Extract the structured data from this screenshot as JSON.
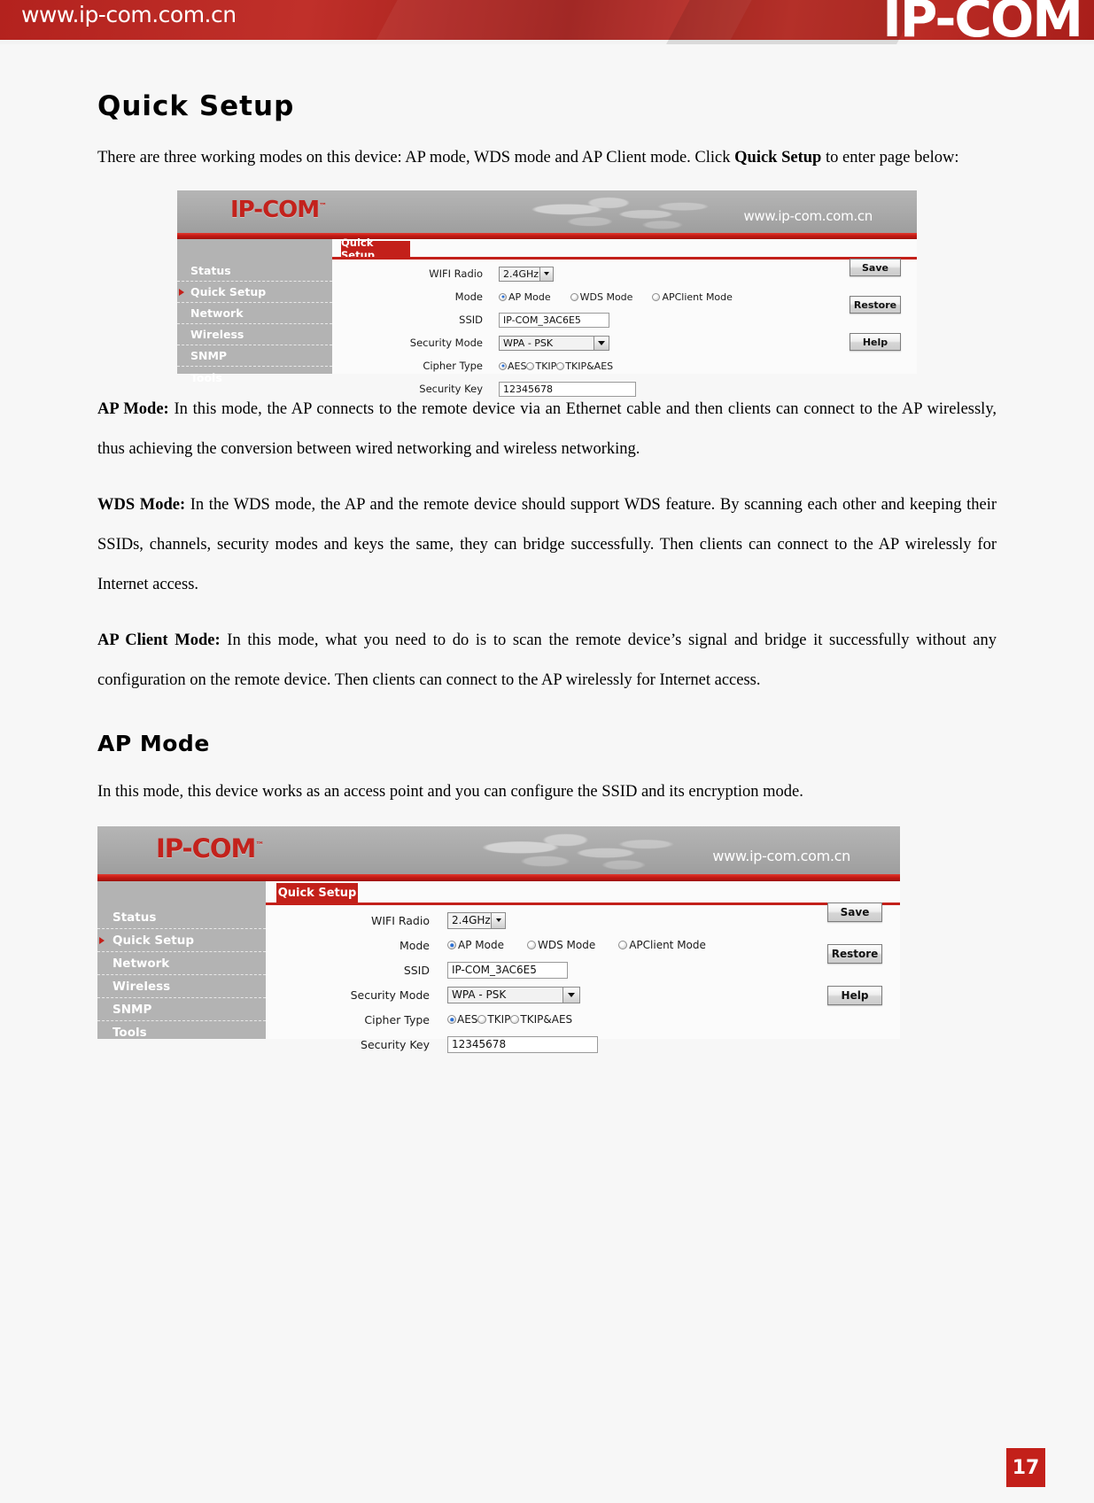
{
  "banner": {
    "url": "www.ip-com.com.cn",
    "logo": "IP-COM"
  },
  "document": {
    "title": "Quick Setup",
    "intro_part1": "There are three working modes on this device: AP mode, WDS mode and AP Client mode. Click ",
    "intro_bold": "Quick Setup",
    "intro_part2": " to enter page below:",
    "ap_mode_label": "AP Mode:",
    "ap_mode_text": " In this mode, the AP connects to the remote device via an Ethernet cable and then clients can connect to the AP wirelessly, thus achieving the conversion between wired networking and wireless networking.",
    "wds_mode_label": "WDS Mode:",
    "wds_mode_text": " In the WDS mode, the AP and the remote device should support WDS feature. By scanning each other and keeping their SSIDs, channels, security modes and keys the same, they can bridge successfully. Then clients can connect to the AP wirelessly for Internet access.",
    "ap_client_mode_label": "AP Client Mode:",
    "ap_client_mode_text": " In this mode, what you need to do is to scan the remote device’s signal and bridge it successfully without any configuration on the remote device. Then clients can connect to the AP wirelessly for Internet access.",
    "section2_title": "AP Mode",
    "section2_text": "In this mode, this device works as an access point and you can configure the SSID and its encryption mode.",
    "page_number": "17"
  },
  "router_ui": {
    "logo": "IP-COM",
    "logo_tm": "™",
    "url": "www.ip-com.com.cn",
    "nav_items": [
      {
        "label": "Status",
        "active": false
      },
      {
        "label": "Quick Setup",
        "active": true
      },
      {
        "label": "Network",
        "active": false
      },
      {
        "label": "Wireless",
        "active": false
      },
      {
        "label": "SNMP",
        "active": false
      },
      {
        "label": "Tools",
        "active": false
      }
    ],
    "tab_label": "Quick Setup",
    "fields": {
      "wifi_radio_label": "WIFI Radio",
      "wifi_radio_value": "2.4GHz",
      "mode_label": "Mode",
      "mode_options": [
        {
          "label": "AP Mode",
          "selected": true
        },
        {
          "label": "WDS Mode",
          "selected": false
        },
        {
          "label": "APClient Mode",
          "selected": false
        }
      ],
      "ssid_label": "SSID",
      "ssid_value": "IP-COM_3AC6E5",
      "security_mode_label": "Security Mode",
      "security_mode_value": "WPA - PSK",
      "cipher_type_label": "Cipher Type",
      "cipher_options": [
        {
          "label": "AES",
          "selected": true
        },
        {
          "label": "TKIP",
          "selected": false
        },
        {
          "label": "TKIP&AES",
          "selected": false
        }
      ],
      "security_key_label": "Security Key",
      "security_key_value": "12345678"
    },
    "buttons": [
      {
        "label": "Save"
      },
      {
        "label": "Restore"
      },
      {
        "label": "Help"
      }
    ]
  },
  "colors": {
    "brand_red": "#c3201a",
    "nav_gray": "#b3b3b3",
    "header_gray": "#aaaaaa"
  }
}
